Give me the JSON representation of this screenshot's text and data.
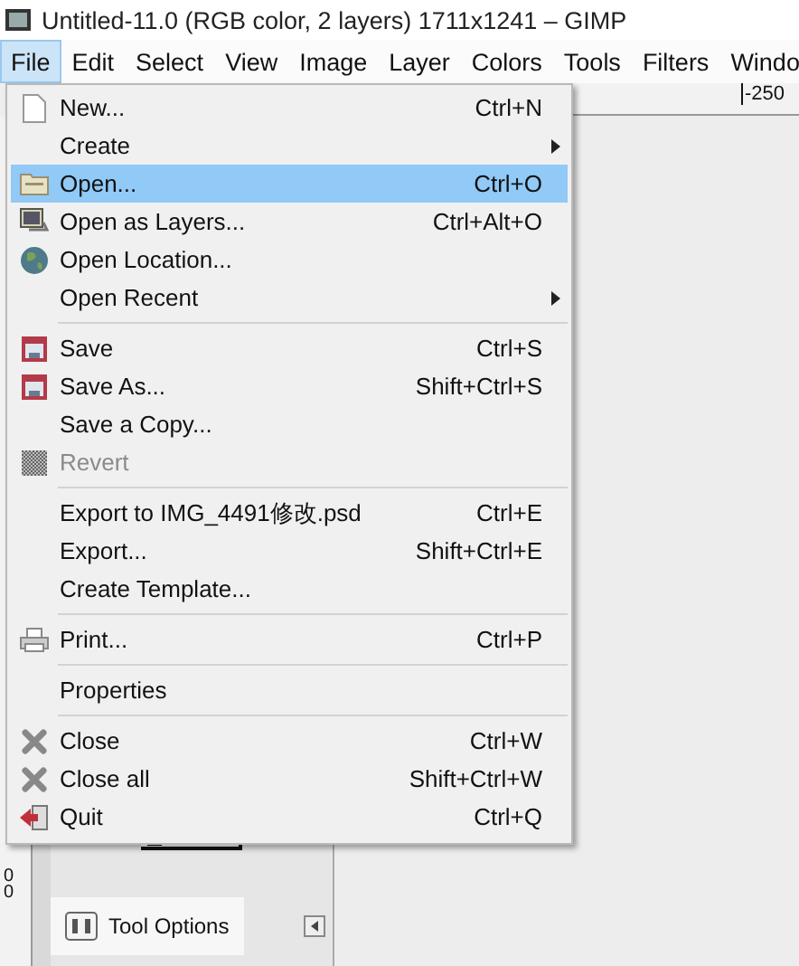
{
  "window": {
    "title": "Untitled-11.0 (RGB color, 2 layers) 1711x1241 – GIMP"
  },
  "menubar": [
    {
      "label": "File",
      "selected": true
    },
    {
      "label": "Edit",
      "selected": false
    },
    {
      "label": "Select",
      "selected": false
    },
    {
      "label": "View",
      "selected": false
    },
    {
      "label": "Image",
      "selected": false
    },
    {
      "label": "Layer",
      "selected": false
    },
    {
      "label": "Colors",
      "selected": false
    },
    {
      "label": "Tools",
      "selected": false
    },
    {
      "label": "Filters",
      "selected": false
    },
    {
      "label": "Windo",
      "selected": false
    }
  ],
  "file_menu": {
    "sections": [
      [
        {
          "label": "New...",
          "shortcut": "Ctrl+N",
          "kind": "document",
          "selected": false,
          "disabled": false
        },
        {
          "label": "Create",
          "submenu": true,
          "selected": false,
          "disabled": false
        },
        {
          "label": "Open...",
          "shortcut": "Ctrl+O",
          "kind": "folder",
          "selected": true,
          "disabled": false
        },
        {
          "label": "Open as Layers...",
          "shortcut": "Ctrl+Alt+O",
          "kind": "image",
          "selected": false,
          "disabled": false
        },
        {
          "label": "Open Location...",
          "kind": "globe",
          "selected": false,
          "disabled": false
        },
        {
          "label": "Open Recent",
          "submenu": true,
          "selected": false,
          "disabled": false
        }
      ],
      [
        {
          "label": "Save",
          "shortcut": "Ctrl+S",
          "kind": "disk",
          "selected": false,
          "disabled": false
        },
        {
          "label": "Save As...",
          "shortcut": "Shift+Ctrl+S",
          "kind": "disk",
          "selected": false,
          "disabled": false
        },
        {
          "label": "Save a Copy...",
          "selected": false,
          "disabled": false
        },
        {
          "label": "Revert",
          "kind": "checker",
          "selected": false,
          "disabled": true
        }
      ],
      [
        {
          "label": "Export to IMG_4491修改.psd",
          "shortcut": "Ctrl+E",
          "selected": false,
          "disabled": false
        },
        {
          "label": "Export...",
          "shortcut": "Shift+Ctrl+E",
          "selected": false,
          "disabled": false
        },
        {
          "label": "Create Template...",
          "selected": false,
          "disabled": false
        }
      ],
      [
        {
          "label": "Print...",
          "shortcut": "Ctrl+P",
          "kind": "printer",
          "selected": false,
          "disabled": false
        }
      ],
      [
        {
          "label": "Properties",
          "selected": false,
          "disabled": false
        }
      ],
      [
        {
          "label": "Close",
          "shortcut": "Ctrl+W",
          "kind": "cross",
          "selected": false,
          "disabled": false
        },
        {
          "label": "Close all",
          "shortcut": "Shift+Ctrl+W",
          "kind": "cross",
          "selected": false,
          "disabled": false
        },
        {
          "label": "Quit",
          "shortcut": "Ctrl+Q",
          "kind": "exit",
          "selected": false,
          "disabled": false
        }
      ]
    ]
  },
  "top_ruler": {
    "label": "-250"
  },
  "left_ruler": {
    "labels": [
      "0",
      "0"
    ]
  },
  "dock": {
    "tab": "Tool Options"
  }
}
